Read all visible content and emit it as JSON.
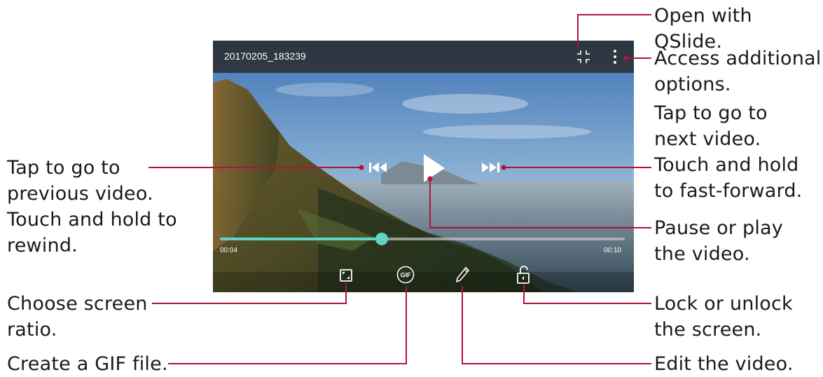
{
  "video": {
    "title": "20170205_183239",
    "elapsed": "00:04",
    "duration": "00:10",
    "progress_fraction": 0.4,
    "accent_color": "#5fd3c4"
  },
  "icons": {
    "qslide": "qslide-icon",
    "more_options": "more-vertical-icon",
    "previous": "skip-previous-icon",
    "play": "play-icon",
    "next": "skip-next-icon",
    "screen_ratio": "screen-ratio-icon",
    "gif": "gif-icon",
    "gif_text": "GIF",
    "edit": "pencil-icon",
    "lock": "unlock-icon"
  },
  "callouts": {
    "qslide": "Open with QSlide.",
    "options": "Access additional\noptions.",
    "next": "Tap to go to\nnext video.\nTouch and hold\nto fast-forward.",
    "play": "Pause or play\nthe video.",
    "lock": "Lock or unlock\nthe screen.",
    "edit": "Edit the video.",
    "previous": "Tap to go to\nprevious video.\nTouch and hold to\nrewind.",
    "ratio": "Choose screen\nratio.",
    "gif": "Create a GIF file."
  },
  "colors": {
    "callout_line": "#b0143c"
  }
}
